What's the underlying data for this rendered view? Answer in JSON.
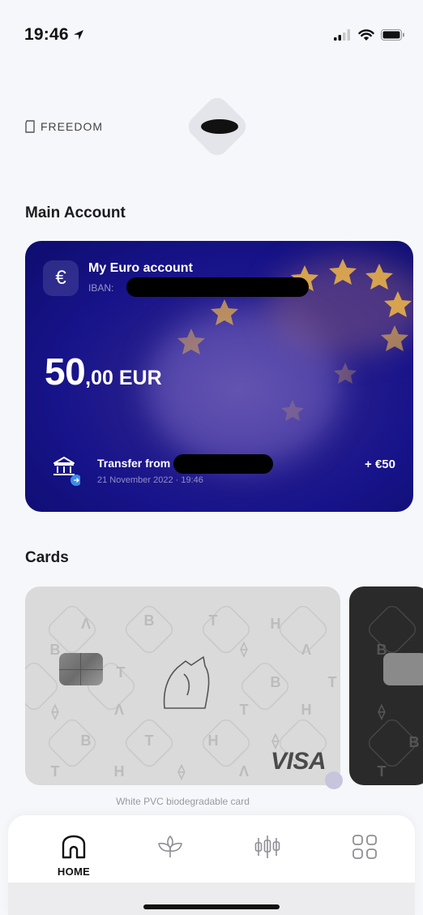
{
  "status_bar": {
    "time": "19:46"
  },
  "header": {
    "plan": "FREEDOM"
  },
  "sections": {
    "main_account": "Main Account",
    "cards": "Cards"
  },
  "account": {
    "name": "My Euro account",
    "iban_label": "IBAN:",
    "balance_major": "50",
    "balance_minor": ",00 EUR",
    "transaction": {
      "title": "Transfer from",
      "date": "21 November 2022 · 19:46",
      "amount": "+ €50"
    }
  },
  "cards": {
    "white_card_caption": "White PVC biodegradable card",
    "brand": "VISA"
  },
  "tab_bar": {
    "items": [
      {
        "label": "HOME",
        "icon": "home-icon",
        "active": true
      },
      {
        "label": "",
        "icon": "leaves-icon",
        "active": false
      },
      {
        "label": "",
        "icon": "candlesticks-icon",
        "active": false
      },
      {
        "label": "",
        "icon": "grid-icon",
        "active": false
      }
    ]
  },
  "colors": {
    "account_card": "#17138a",
    "accent_blue": "#3b8bea",
    "background": "#f6f7fa"
  }
}
